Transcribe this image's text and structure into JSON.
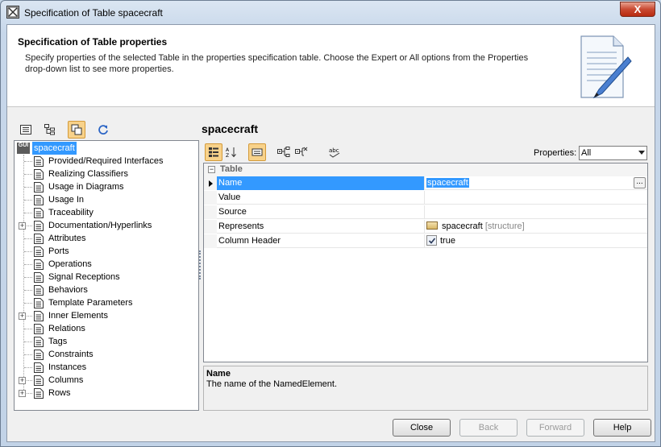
{
  "window": {
    "title": "Specification of Table spacecraft",
    "close_glyph": "X"
  },
  "header": {
    "title": "Specification of Table properties",
    "description": "Specify properties of the selected Table in the properties specification table. Choose the Expert or All options from the Properties drop-down list to see more properties.",
    "graphic_icon": "document-pencil-icon"
  },
  "tree": {
    "toolbar_icons": [
      "list-view-icon",
      "tree-view-icon",
      "copy-icon",
      "refresh-icon"
    ],
    "root": {
      "badge": "GUI",
      "label": "spacecraft"
    },
    "items": [
      {
        "label": "Provided/Required Interfaces",
        "expandable": false
      },
      {
        "label": "Realizing Classifiers",
        "expandable": false
      },
      {
        "label": "Usage in Diagrams",
        "expandable": false
      },
      {
        "label": "Usage In",
        "expandable": false
      },
      {
        "label": "Traceability",
        "expandable": false
      },
      {
        "label": "Documentation/Hyperlinks",
        "expandable": true
      },
      {
        "label": "Attributes",
        "expandable": false
      },
      {
        "label": "Ports",
        "expandable": false
      },
      {
        "label": "Operations",
        "expandable": false
      },
      {
        "label": "Signal Receptions",
        "expandable": false
      },
      {
        "label": "Behaviors",
        "expandable": false
      },
      {
        "label": "Template Parameters",
        "expandable": false
      },
      {
        "label": "Inner Elements",
        "expandable": true
      },
      {
        "label": "Relations",
        "expandable": false
      },
      {
        "label": "Tags",
        "expandable": false
      },
      {
        "label": "Constraints",
        "expandable": false
      },
      {
        "label": "Instances",
        "expandable": false
      },
      {
        "label": "Columns",
        "expandable": true
      },
      {
        "label": "Rows",
        "expandable": true
      }
    ]
  },
  "spec": {
    "element_name": "spacecraft",
    "toolbar_icons": [
      "categorized-icon",
      "sort-alpha-icon",
      "hide-empty-icon",
      "expand-all-icon",
      "collapse-all-icon",
      "spelling-icon"
    ],
    "properties_label": "Properties:",
    "properties_value": "All",
    "section": "Table",
    "rows": [
      {
        "name": "Name",
        "value": "spacecraft",
        "selected": true
      },
      {
        "name": "Value",
        "value": ""
      },
      {
        "name": "Source",
        "value": ""
      },
      {
        "name": "Represents",
        "value": "spacecraft",
        "value_suffix": "[structure]"
      },
      {
        "name": "Column Header",
        "value": "true",
        "checked": true
      }
    ],
    "ellipsis": "...",
    "description": {
      "name": "Name",
      "text": "The name of the NamedElement."
    }
  },
  "buttons": {
    "close": "Close",
    "back": "Back",
    "forward": "Forward",
    "help": "Help"
  },
  "colors": {
    "selection": "#3399ff",
    "active_tool": "#f8d28a"
  }
}
